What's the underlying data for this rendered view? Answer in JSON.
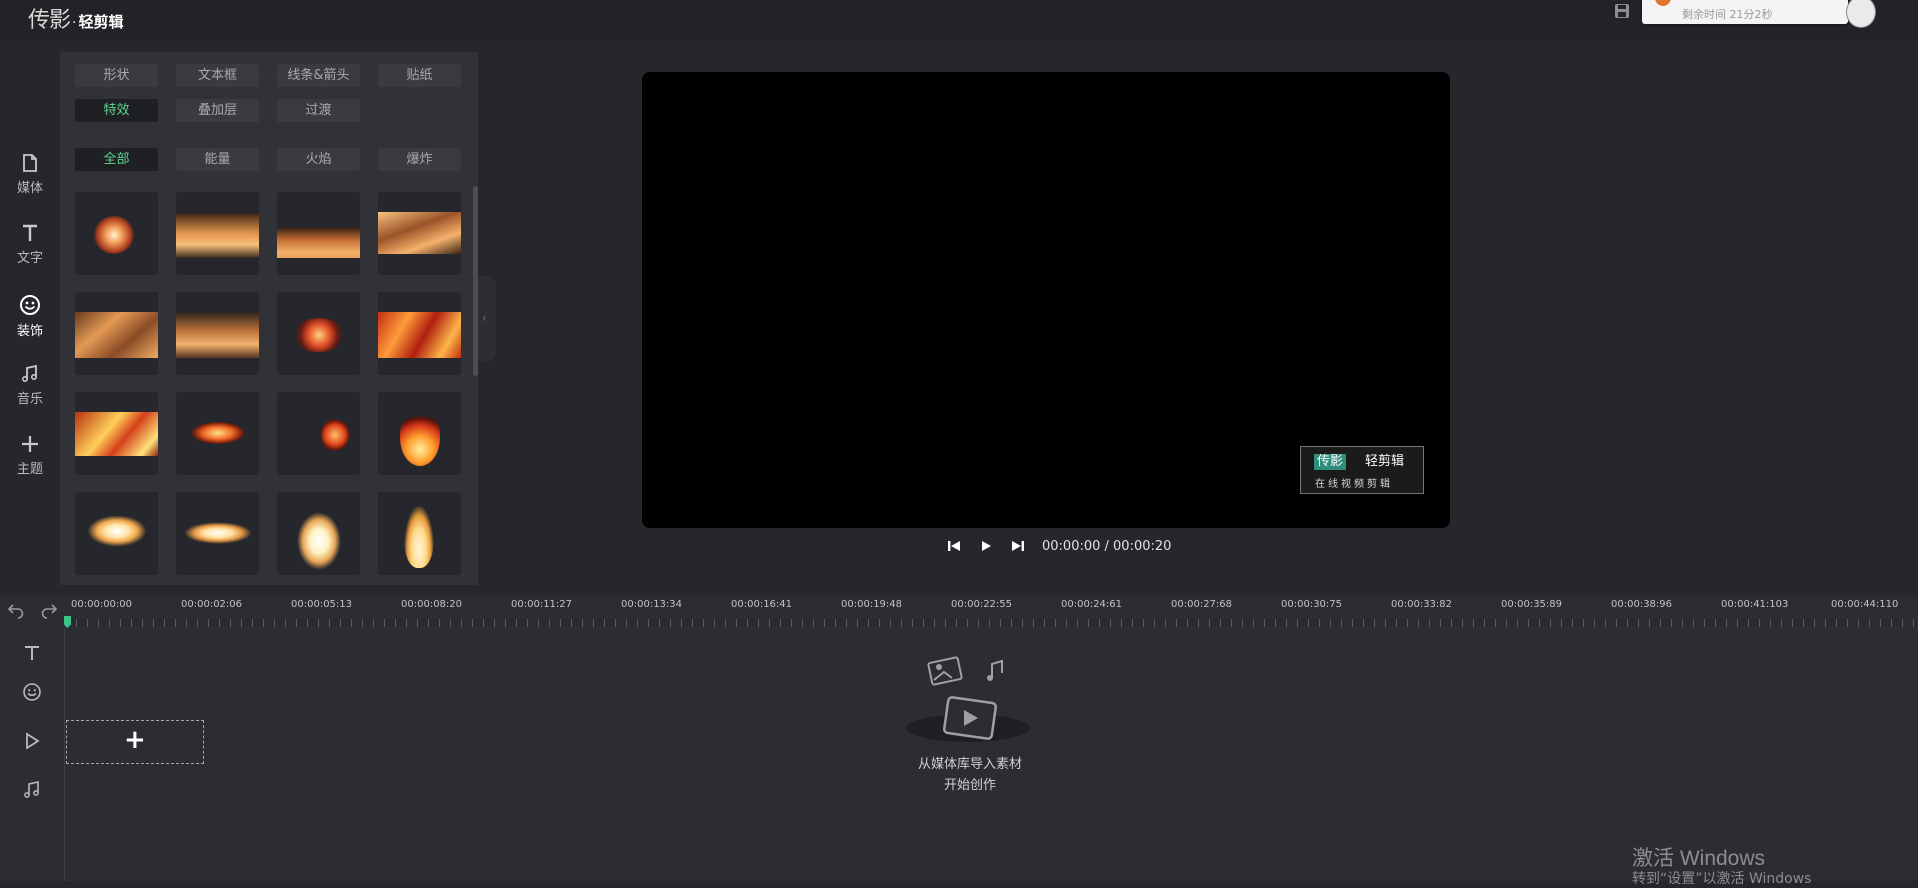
{
  "app": {
    "logo_main": "传影",
    "logo_sep": "·",
    "logo_sub": "轻剪辑",
    "notice_text": "剩余时间 21分2秒",
    "save_icon": "save-icon",
    "avatar_icon": "avatar"
  },
  "leftnav": {
    "items": [
      {
        "label": "媒体",
        "icon": "file-icon"
      },
      {
        "label": "文字",
        "icon": "text-icon"
      },
      {
        "label": "装饰",
        "icon": "smiley-icon",
        "active": true
      },
      {
        "label": "音乐",
        "icon": "music-icon"
      },
      {
        "label": "主题",
        "icon": "plus-icon"
      }
    ]
  },
  "panel": {
    "type_tabs": [
      "形状",
      "文本框",
      "线条&箭头",
      "贴纸",
      "特效",
      "叠加层",
      "过渡"
    ],
    "active_type_tab": "特效",
    "filter_tabs": [
      "全部",
      "能量",
      "火焰",
      "爆炸"
    ],
    "active_filter_tab": "全部",
    "thumbnail_count": 16
  },
  "preview": {
    "watermark_brand": "传影",
    "watermark_title": "轻剪辑",
    "watermark_subtitle": "在线视频剪辑",
    "timecode": "00:00:00 / 00:00:20"
  },
  "timeline": {
    "ticks": [
      "00:00:00:00",
      "00:00:02:06",
      "00:00:05:13",
      "00:00:08:20",
      "00:00:11:27",
      "00:00:13:34",
      "00:00:16:41",
      "00:00:19:48",
      "00:00:22:55",
      "00:00:24:61",
      "00:00:27:68",
      "00:00:30:75",
      "00:00:33:82",
      "00:00:35:89",
      "00:00:38:96",
      "00:00:41:103",
      "00:00:44:110"
    ],
    "track_icons": [
      "text-icon",
      "smiley-icon",
      "play-icon",
      "music-icon"
    ],
    "add_label": "+",
    "empty_line1": "从媒体库导入素材",
    "empty_line2": "开始创作"
  },
  "system": {
    "activate_title": "激活 Windows",
    "activate_sub": "转到“设置”以激活 Windows"
  },
  "colors": {
    "accent": "#5ed58e",
    "panel": "#313238",
    "background": "#26272c"
  }
}
